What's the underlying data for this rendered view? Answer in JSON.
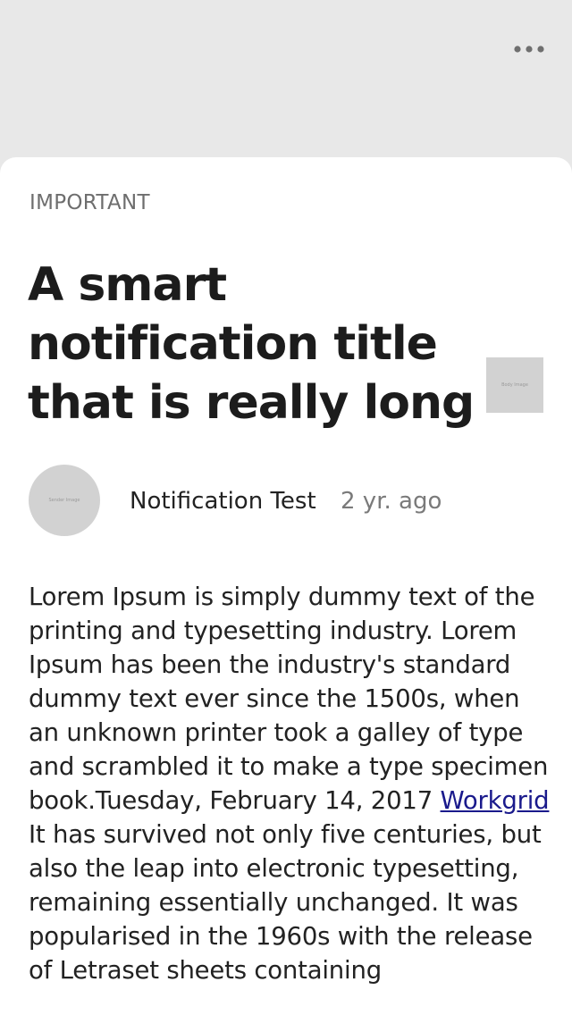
{
  "header": {
    "more_icon": "more-horizontal-icon"
  },
  "notification": {
    "category": "IMPORTANT",
    "title": "A smart notification title that is really long",
    "body_image_label": "Body Image",
    "sender_image_label": "Sender Image",
    "sender_name": "Notification Test",
    "time_ago": "2 yr. ago",
    "body_part1": "Lorem Ipsum is simply dummy text of the printing and typesetting industry. Lorem Ipsum has been the industry's standard dummy text ever since the 1500s, when an unknown printer took a galley of type and scrambled it to make a type specimen book.Tuesday, February 14, 2017 ",
    "body_link": "Workgrid",
    "body_part2": " It has survived not only five centuries, but also the leap into electronic typesetting, remaining essentially unchanged. It was popularised in the 1960s with the release of Letraset sheets containing"
  },
  "colors": {
    "background": "#e8e8e8",
    "card": "#ffffff",
    "link": "#1a1a8c",
    "placeholder": "#d2d2d2"
  }
}
